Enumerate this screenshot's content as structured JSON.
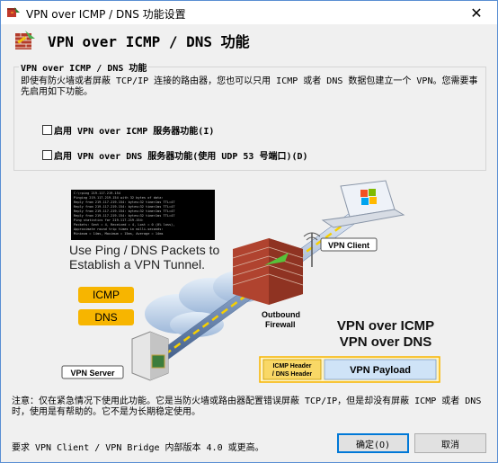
{
  "window": {
    "title": "VPN over ICMP / DNS 功能设置",
    "close_glyph": "✕"
  },
  "header": {
    "title": "VPN over ICMP / DNS 功能"
  },
  "group": {
    "legend": "VPN over ICMP / DNS 功能",
    "description": "即使有防火墙或者屏蔽 TCP/IP 连接的路由器，您也可以只用 ICMP 或者 DNS 数据包建立一个 VPN。您需要事先启用如下功能。",
    "checkbox_icmp": "启用 VPN over ICMP 服务器功能(I)",
    "checkbox_dns": "启用 VPN over DNS 服务器功能(使用 UDP 53 号端口)(D)"
  },
  "illustration": {
    "terminal_lines": [
      "C:\\>ping 219.117.219.154",
      "Pinging 219.117.219.154 with 32 bytes of data:",
      "Reply from 219.117.219.154: bytes=32 time<1ms TTL=47",
      "Reply from 219.117.219.154: bytes=32 time<1ms TTL=47",
      "Reply from 219.117.219.154: bytes=32 time<1ms TTL=47",
      "Reply from 219.117.219.154: bytes=32 time<1ms TTL=47",
      "Ping statistics for 219.117.219.154:",
      "    Packets: Sent = 4, Received = 4, Lost = 0 (0% loss),",
      "Approximate round trip times in milli-seconds:",
      "    Minimum = 14ms, Maximum = 15ms, Average = 14ms"
    ],
    "caption_line1": "Use Ping / DNS Packets to",
    "caption_line2": "Establish a VPN Tunnel.",
    "badge_icmp": "ICMP",
    "badge_dns": "DNS",
    "vpn_client": "VPN Client",
    "vpn_server": "VPN Server",
    "firewall_line1": "Outbound",
    "firewall_line2": "Firewall",
    "big_line1": "VPN over ICMP",
    "big_line2": "VPN over DNS",
    "header_box_line1": "ICMP Header",
    "header_box_line2": "/ DNS Header",
    "payload": "VPN Payload",
    "colors": {
      "badge": "#f7b500",
      "payload_fill": "#cfe3f7",
      "payload_border": "#f7b500",
      "header_fill": "#f9d866",
      "terminal_bg": "#000000",
      "terminal_text": "#c0c0c0"
    }
  },
  "note": "注意：仅在紧急情况下使用此功能。它是当防火墙或路由器配置错误屏蔽 TCP/IP，但是却没有屏蔽 ICMP 或者 DNS 时，使用是有帮助的。它不是为长期稳定使用。",
  "footer": {
    "requirement": "要求 VPN Client / VPN Bridge 内部版本 4.0 或更高。",
    "ok_label": "确定(O)",
    "cancel_label": "取消"
  }
}
